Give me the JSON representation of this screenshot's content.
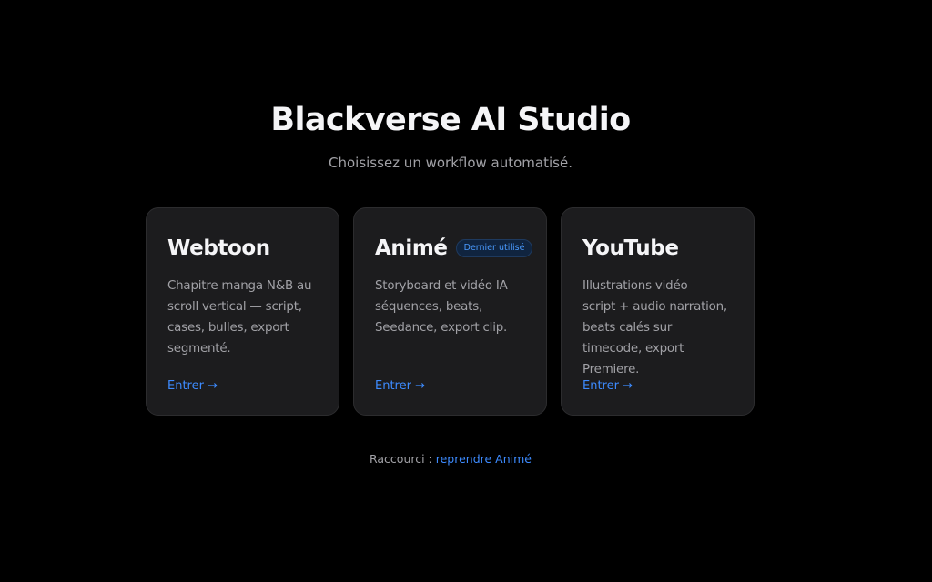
{
  "header": {
    "title": "Blackverse AI Studio",
    "subtitle": "Choisissez un workflow automatisé."
  },
  "cards": [
    {
      "title": "Webtoon",
      "badge": "",
      "description": "Chapitre manga N&B au scroll vertical — script, cases, bulles, export segmenté.",
      "link": "Entrer →"
    },
    {
      "title": "Animé",
      "badge": "Dernier utilisé",
      "description": "Storyboard et vidéo IA — séquences, beats, Seedance, export clip.",
      "link": "Entrer →"
    },
    {
      "title": "YouTube",
      "badge": "",
      "description": "Illustrations vidéo — script + audio narration, beats calés sur timecode, export Premiere.",
      "link": "Entrer →"
    }
  ],
  "shortcut": {
    "label": "Raccourci :",
    "link": "reprendre Animé"
  },
  "colors": {
    "background": "#000000",
    "card": "#1c1c1e",
    "accent": "#3d8bff",
    "text": "#f5f5f7",
    "muted": "#a1a1a6"
  }
}
